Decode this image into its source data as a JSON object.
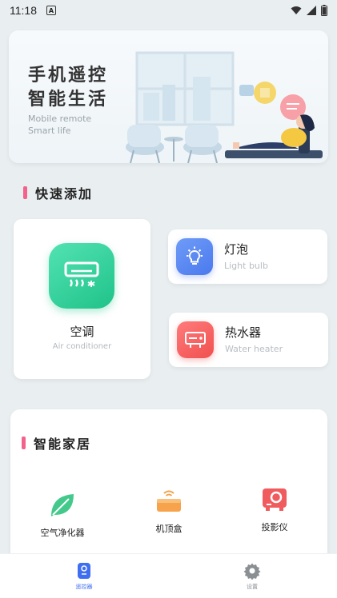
{
  "status_bar": {
    "time": "11:18",
    "sim_label": "A"
  },
  "banner": {
    "title_line1": "手机遥控",
    "title_line2": "智能生活",
    "subtitle_line1": "Mobile remote",
    "subtitle_line2": "Smart life"
  },
  "quick_add": {
    "title": "快速添加",
    "accent_color": "#f2628c",
    "devices": [
      {
        "name": "空调",
        "sub": "Air conditioner",
        "icon": "air-conditioner-icon",
        "color": "#2ccf95"
      },
      {
        "name": "灯泡",
        "sub": "Light bulb",
        "icon": "light-bulb-icon",
        "color": "#5a86f2"
      },
      {
        "name": "热水器",
        "sub": "Water heater",
        "icon": "water-heater-icon",
        "color": "#f45b5a"
      }
    ]
  },
  "smart_home": {
    "title": "智能家居",
    "items": [
      {
        "name": "空气净化器",
        "icon": "leaf-icon"
      },
      {
        "name": "机顶盒",
        "icon": "set-top-box-icon"
      },
      {
        "name": "投影仪",
        "icon": "projector-icon"
      }
    ]
  },
  "tabbar": {
    "items": [
      {
        "label": "遥控器",
        "icon": "remote-icon",
        "active": true,
        "color": "#3e6ff2"
      },
      {
        "label": "设置",
        "icon": "gear-icon",
        "active": false,
        "color": "#8a8f94"
      }
    ]
  }
}
